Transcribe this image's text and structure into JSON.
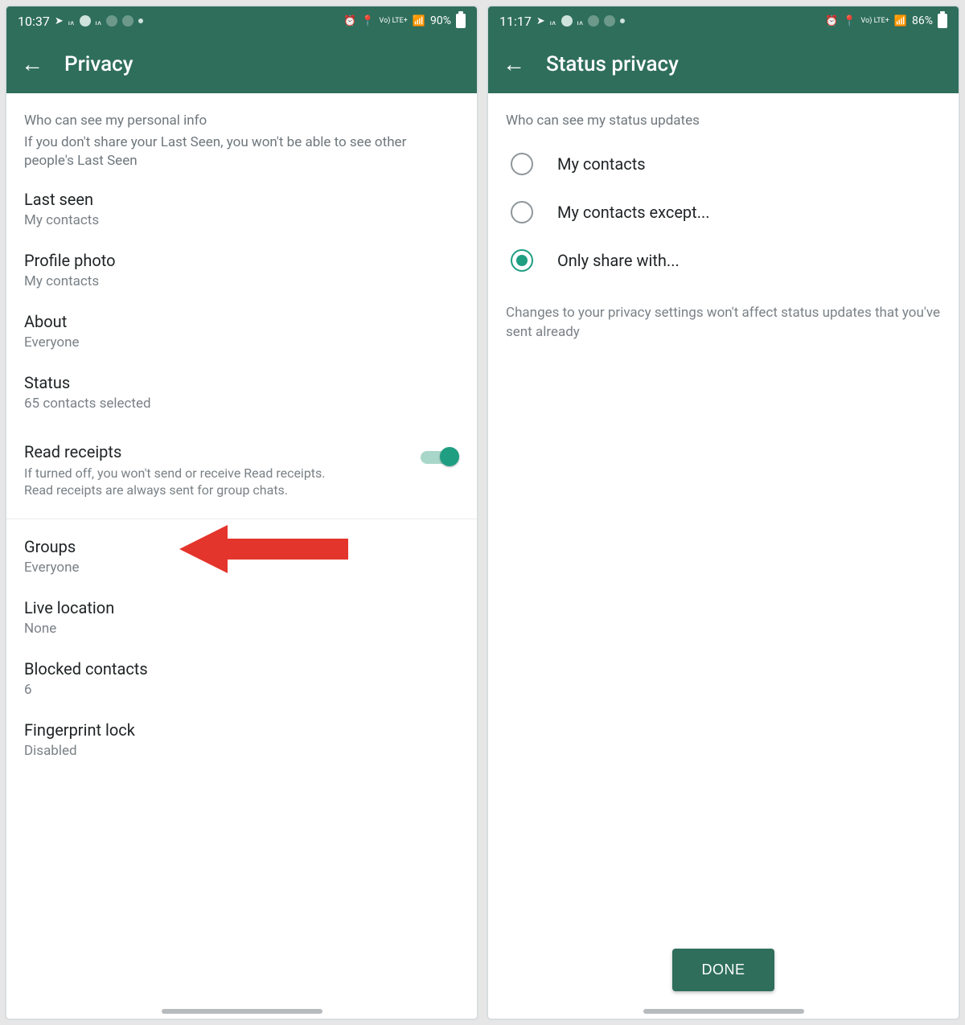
{
  "left": {
    "status": {
      "time": "10:37",
      "battery": "90%",
      "network": "Vo) LTE+"
    },
    "title": "Privacy",
    "header": "Who can see my personal info",
    "headerSub": "If you don't share your Last Seen, you won't be able to see other people's Last Seen",
    "items": {
      "lastSeen": {
        "label": "Last seen",
        "value": "My contacts"
      },
      "profile": {
        "label": "Profile photo",
        "value": "My contacts"
      },
      "about": {
        "label": "About",
        "value": "Everyone"
      },
      "status": {
        "label": "Status",
        "value": "65 contacts selected"
      },
      "read": {
        "label": "Read receipts",
        "desc": "If turned off, you won't send or receive Read receipts. Read receipts are always sent for group chats."
      },
      "groups": {
        "label": "Groups",
        "value": "Everyone"
      },
      "live": {
        "label": "Live location",
        "value": "None"
      },
      "blocked": {
        "label": "Blocked contacts",
        "value": "6"
      },
      "finger": {
        "label": "Fingerprint lock",
        "value": "Disabled"
      }
    }
  },
  "right": {
    "status": {
      "time": "11:17",
      "battery": "86%",
      "network": "Vo) LTE+"
    },
    "title": "Status privacy",
    "header": "Who can see my status updates",
    "options": [
      {
        "label": "My contacts",
        "selected": false
      },
      {
        "label": "My contacts except...",
        "selected": false
      },
      {
        "label": "Only share with...",
        "selected": true
      }
    ],
    "note": "Changes to your privacy settings won't affect status updates that you've sent already",
    "done": "DONE"
  }
}
